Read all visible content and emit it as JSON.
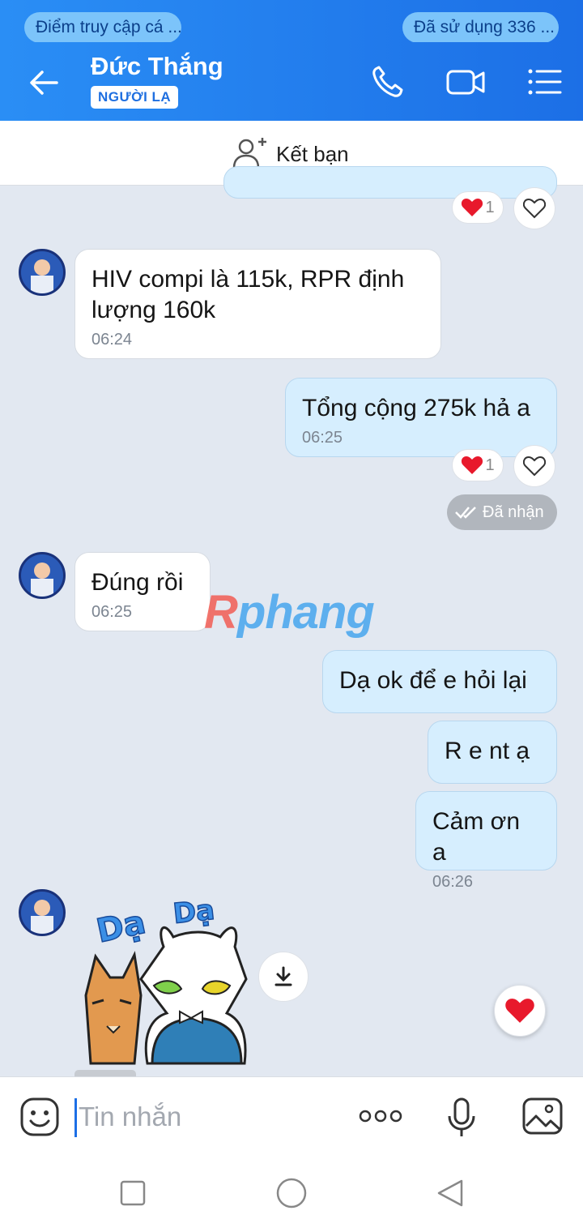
{
  "status_bar": {
    "left_pill": "Điểm truy cập cá ...",
    "right_pill": "Đã sử dụng  336 ..."
  },
  "header": {
    "contact_name": "Đức Thắng",
    "contact_tag": "NGƯỜI LẠ",
    "icons": [
      "back-arrow-icon",
      "phone-icon",
      "video-call-icon",
      "menu-list-icon"
    ]
  },
  "friend_bar": {
    "label": "Kết bạn",
    "icon": "add-friend-icon"
  },
  "messages": [
    {
      "side": "in",
      "text": "HIV compi là 115k, RPR định lượng 160k",
      "time": "06:24"
    },
    {
      "side": "out",
      "text": "Tổng cộng 275k hả a",
      "time": "06:25",
      "reaction_count": "1"
    },
    {
      "side": "in",
      "text": "Đúng rồi",
      "time": "06:25"
    },
    {
      "side": "out",
      "text": "Dạ ok để e hỏi lại"
    },
    {
      "side": "out",
      "text": "R e nt ạ"
    },
    {
      "side": "out",
      "text": "Cảm ơn a",
      "time": "06:26"
    }
  ],
  "top_reaction_count": "1",
  "delivery_status": "Đã nhận",
  "watermark": {
    "part1": "R",
    "part2": "phang"
  },
  "sticker": {
    "text1": "Dạ",
    "text2": "Dạ"
  },
  "composer": {
    "placeholder": "Tin nhắn"
  },
  "colors": {
    "header_blue": "#1c6fe6",
    "bubble_out": "#d6eefe",
    "bubble_in": "#ffffff",
    "chat_bg": "#e2e8f1",
    "heart": "#e8192c"
  }
}
